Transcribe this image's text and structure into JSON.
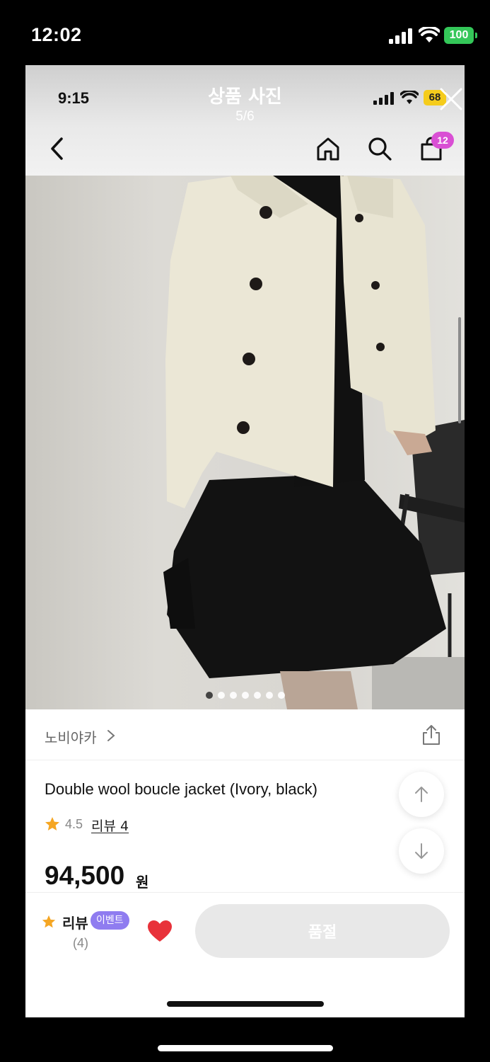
{
  "outer_status": {
    "time": "12:02",
    "battery": "100"
  },
  "inner_status": {
    "time": "9:15",
    "battery": "68"
  },
  "viewer": {
    "title": "상품 사진",
    "counter": "5/6"
  },
  "nav": {
    "cart_count": "12"
  },
  "photo": {
    "dot_count": 7,
    "active_dot": 0
  },
  "product": {
    "brand": "노비야카",
    "title": "Double wool boucle jacket (Ivory, black)",
    "rating": "4.5",
    "review_label": "리뷰 4",
    "price": "94,500",
    "price_unit": "원"
  },
  "bottom_bar": {
    "review_label": "리뷰",
    "event_badge": "이벤트",
    "review_count": "(4)",
    "soldout_label": "품절"
  },
  "colors": {
    "cart_badge": "#d94fd4",
    "event_badge": "#8f7cf0",
    "heart": "#e8323a",
    "star": "#f5a623",
    "outer_battery": "#34c759",
    "inner_battery": "#f5cc1c"
  }
}
